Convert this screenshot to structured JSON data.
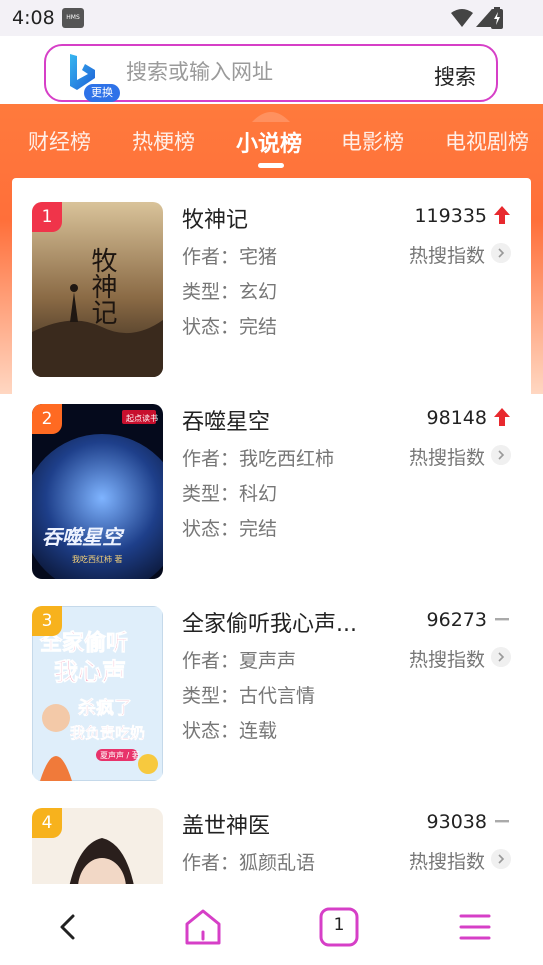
{
  "status": {
    "time": "4:08",
    "hms_badge": "HMS"
  },
  "search": {
    "placeholder": "搜索或输入网址",
    "button_label": "搜索",
    "swap_label": "更换"
  },
  "tabs": [
    {
      "label": "财经榜",
      "active": false
    },
    {
      "label": "热梗榜",
      "active": false
    },
    {
      "label": "小说榜",
      "active": true
    },
    {
      "label": "电影榜",
      "active": false
    },
    {
      "label": "电视剧榜",
      "active": false
    }
  ],
  "novels": [
    {
      "rank": "1",
      "title": "牧神记",
      "author": "作者：宅猪",
      "genre": "类型：玄幻",
      "status": "状态：完结",
      "count": "119335",
      "trend": "up",
      "hot_label": "热搜指数",
      "rank_color": "#f0344a"
    },
    {
      "rank": "2",
      "title": "吞噬星空",
      "author": "作者：我吃西红柿",
      "genre": "类型：科幻",
      "status": "状态：完结",
      "count": "98148",
      "trend": "up",
      "hot_label": "热搜指数",
      "rank_color": "#ff6a22"
    },
    {
      "rank": "3",
      "title": "全家偷听我心声...",
      "author": "作者：夏声声",
      "genre": "类型：古代言情",
      "status": "状态：连载",
      "count": "96273",
      "trend": "flat",
      "hot_label": "热搜指数",
      "rank_color": "#f7b21d"
    },
    {
      "rank": "4",
      "title": "盖世神医",
      "author": "作者：狐颜乱语",
      "genre": "",
      "status": "",
      "count": "93038",
      "trend": "flat",
      "hot_label": "热搜指数",
      "rank_color": "#f7b21d"
    }
  ],
  "covers": [
    {
      "text": "牧神记"
    },
    {
      "text": "吞噬星空",
      "publisher": "起点读书",
      "author_line": "我吃西红柿 著"
    },
    {
      "text_line1": "全家偷听",
      "text_line2": "我心声",
      "text_line3": "杀疯了",
      "text_line4": "我负责吃奶",
      "author_line": "夏声声 / 著"
    },
    {}
  ],
  "bottom_nav": {
    "tab_count": "1"
  },
  "colors": {
    "accent_pink": "#d63fc7",
    "orange": "#ff6f3a",
    "trend_up": "#e8292e"
  }
}
